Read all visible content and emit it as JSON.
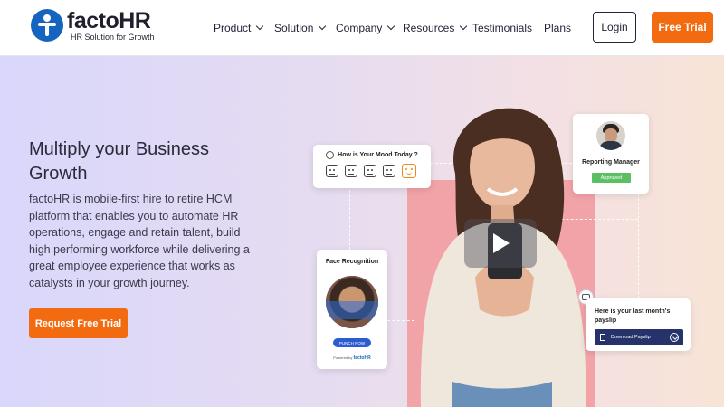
{
  "brand": {
    "name": "factoHR",
    "tagline": "HR Solution for Growth",
    "accent": "#f26b10",
    "logo_color": "#1565c0"
  },
  "nav": {
    "items": [
      {
        "label": "Product",
        "dropdown": true
      },
      {
        "label": "Solution",
        "dropdown": true
      },
      {
        "label": "Company",
        "dropdown": true
      },
      {
        "label": "Resources",
        "dropdown": true
      },
      {
        "label": "Testimonials",
        "dropdown": false
      },
      {
        "label": "Plans",
        "dropdown": false
      }
    ],
    "login_label": "Login",
    "trial_label": "Free Trial"
  },
  "hero": {
    "title": "Multiply your Business Growth",
    "description": "factoHR is mobile-first hire to retire HCM platform that enables you to automate HR operations, engage and retain talent, build high performing workforce while delivering a great employee experience that works as catalysts in your growth journey.",
    "cta_label": "Request Free Trial"
  },
  "cards": {
    "mood": {
      "title": "How is Your Mood Today ?",
      "faces": [
        "very-sad-face-icon",
        "sad-face-icon",
        "neutral-face-icon",
        "smile-face-icon",
        "happy-face-icon"
      ],
      "selected": 4
    },
    "manager": {
      "title": "Reporting Manager",
      "status": "Approved",
      "status_color": "#5bbf63"
    },
    "face_recognition": {
      "title": "Face Recognition",
      "button": "PUNCH NOW",
      "powered_prefix": "Powered by",
      "powered_brand": "factoHR"
    },
    "payslip": {
      "text": "Here is your last month's payslip",
      "button": "Download Payslip"
    }
  }
}
